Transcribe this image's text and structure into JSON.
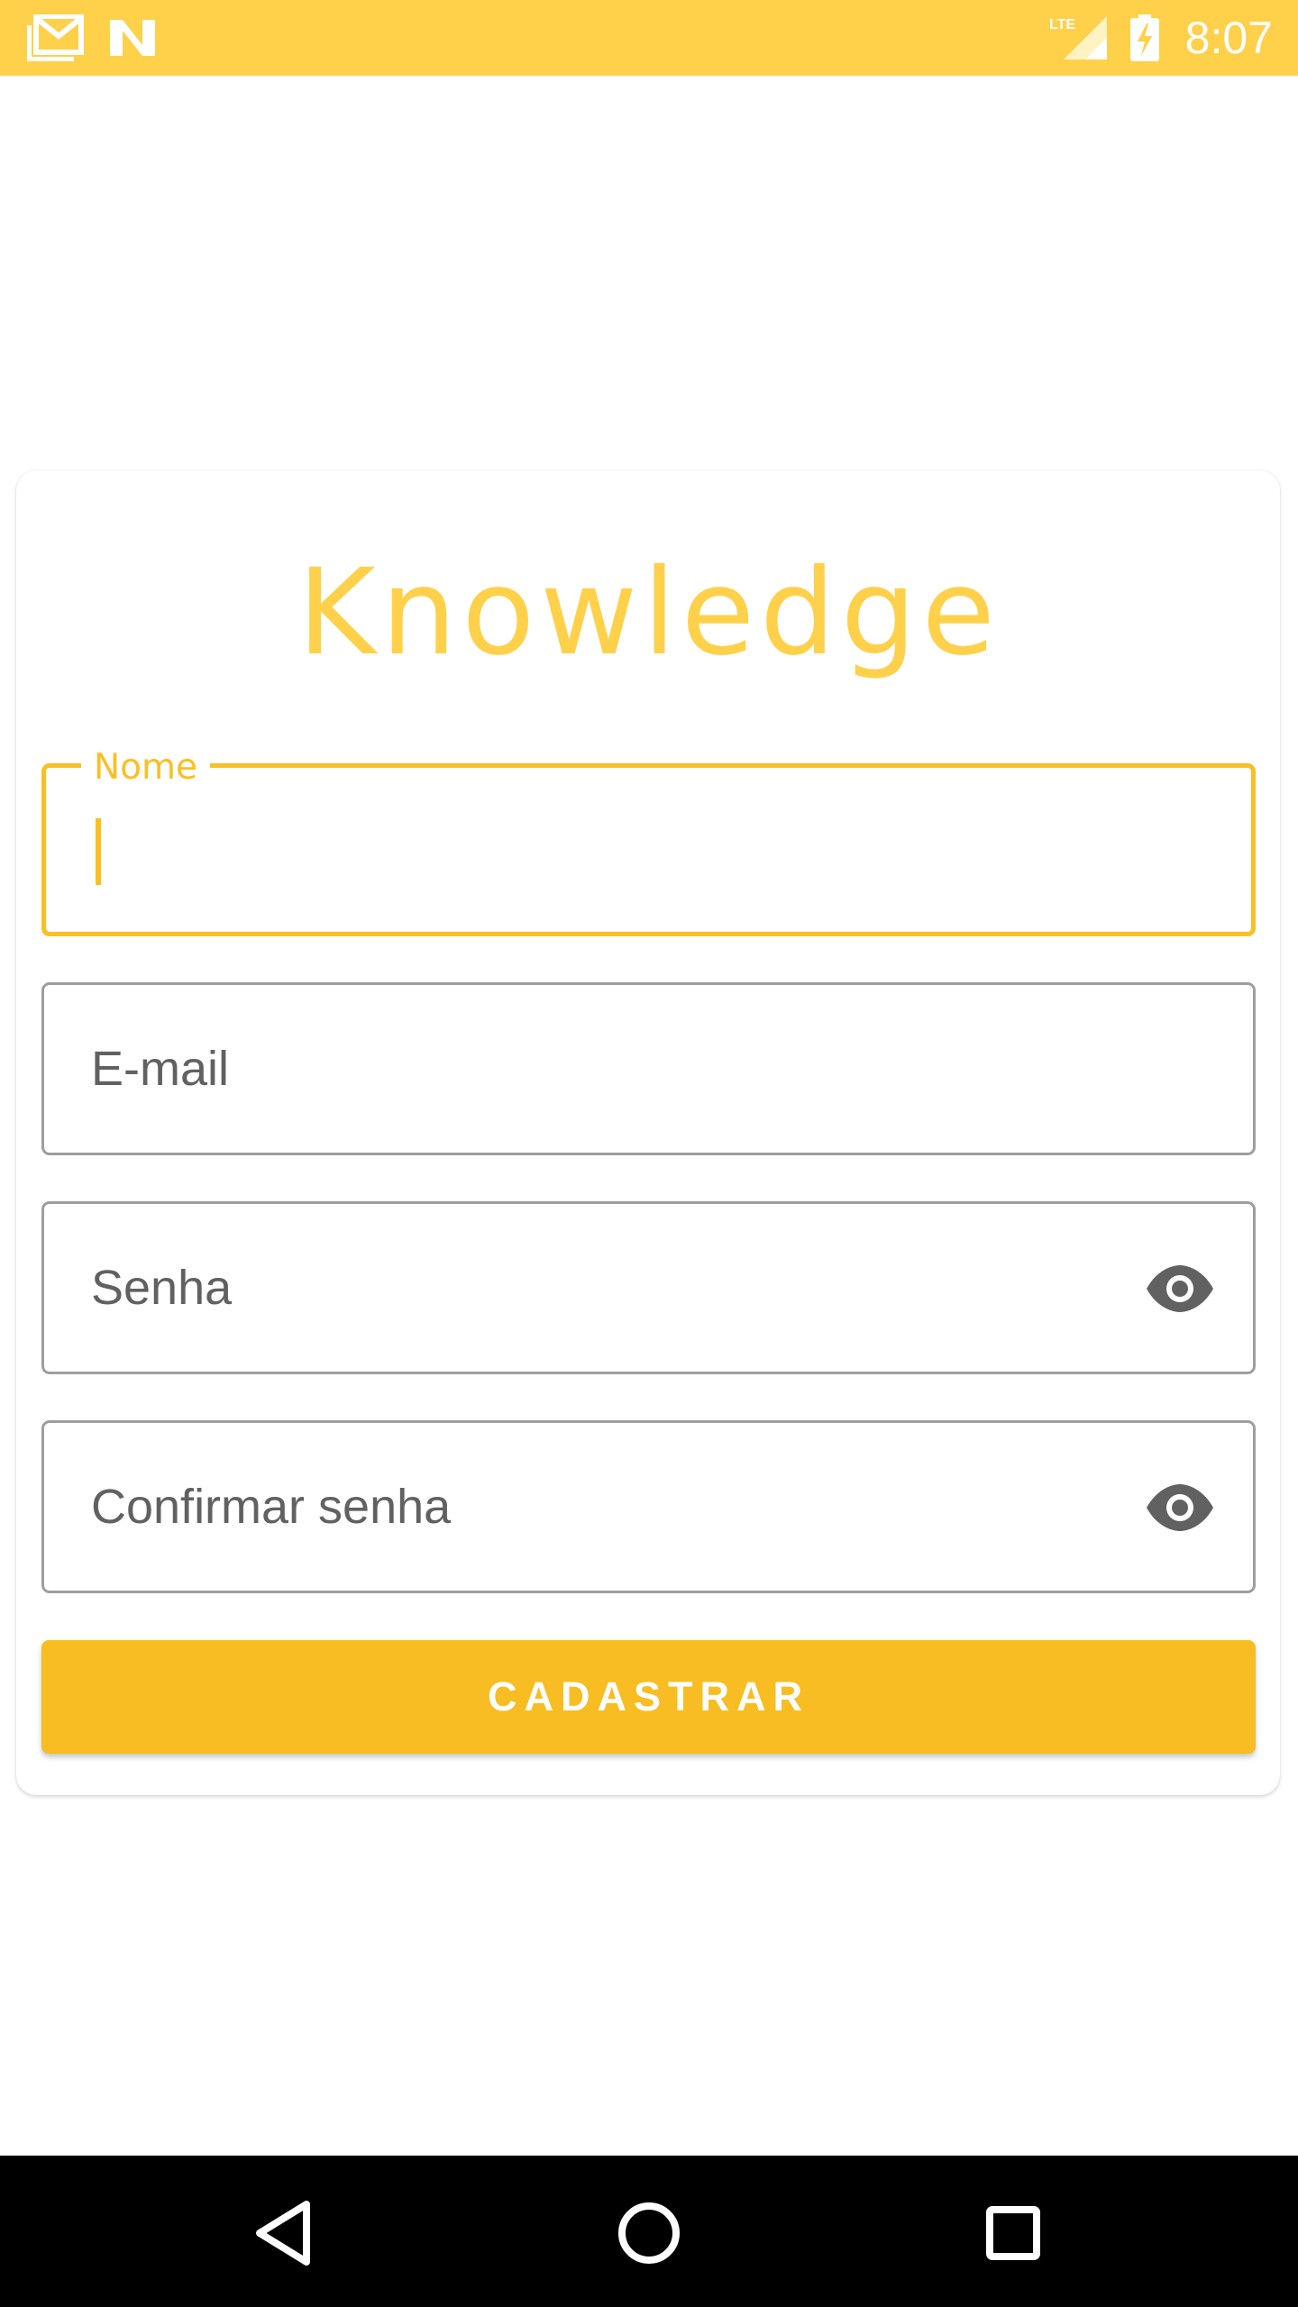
{
  "status_bar": {
    "time": "8:07",
    "network": "LTE",
    "icons": [
      "gmail-icon",
      "n-app-icon",
      "lte-signal-icon",
      "battery-charging-icon"
    ],
    "color": "#ffd04a"
  },
  "app": {
    "title": "Knowledge",
    "accent_color": "#fbbf24"
  },
  "form": {
    "name_label": "Nome",
    "email_placeholder": "E-mail",
    "password_placeholder": "Senha",
    "confirm_password_placeholder": "Confirmar senha",
    "submit_label": "CADASTRAR"
  },
  "nav_bar": {
    "icons": [
      "back-icon",
      "home-icon",
      "recents-icon"
    ]
  }
}
